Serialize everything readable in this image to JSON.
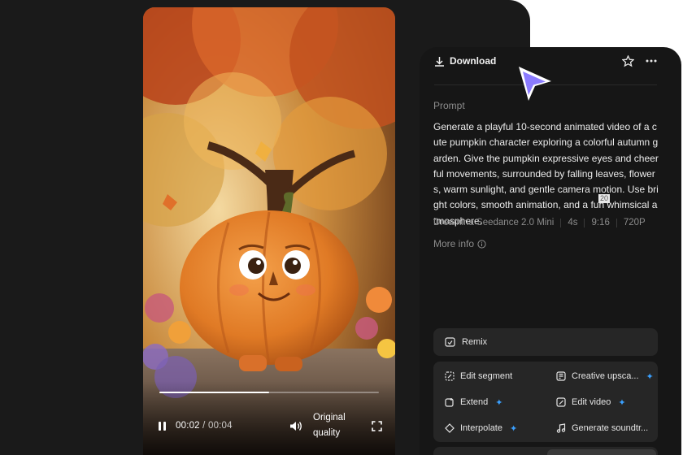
{
  "player": {
    "current_time": "00:02",
    "separator": " / ",
    "duration": "00:04",
    "progress_fraction": 0.5,
    "quality_label": "Original quality"
  },
  "header": {
    "download_label": "Download",
    "icons": [
      "download-icon",
      "star-icon",
      "more-icon"
    ]
  },
  "prompt": {
    "label": "Prompt",
    "text": "Generate a playful 10-second animated video of a cute pumpkin character exploring a colorful autumn garden. Give the pumpkin expressive eyes and cheerful movements, surrounded by falling leaves, flowers, warm sunlight, and gentle camera motion. Use bright colors, smooth animation, and a fun whimsical atmosphere.",
    "overlay_badge": "20"
  },
  "meta": {
    "model": "Dreamina Seedance 2.0 Mini",
    "length": "4s",
    "ratio": "9:16",
    "resolution": "720P"
  },
  "more_info_label": "More info",
  "actions": {
    "remix": "Remix",
    "edit_segment": "Edit segment",
    "creative_upscale": "Creative upsca...",
    "extend": "Extend",
    "edit_video": "Edit video",
    "interpolate": "Interpolate",
    "generate_soundtrack": "Generate soundtr..."
  },
  "colors": {
    "accent_blue": "#3aa0ff",
    "cursor": "#8b7bff"
  }
}
